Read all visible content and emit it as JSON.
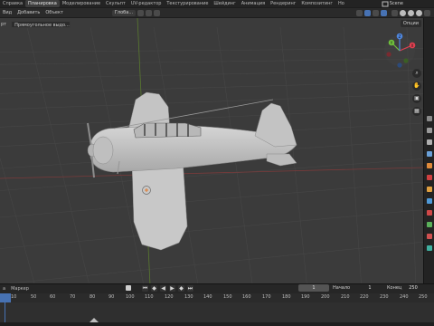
{
  "topbar": {
    "workspaces": [
      "Справка",
      "Планировка",
      "Моделирование",
      "Скульпт",
      "UV-редактор",
      "Текстурирование",
      "Шейдинг",
      "Анимация",
      "Рендеринг",
      "Композитинг",
      "Но"
    ],
    "active_workspace": "Планировка",
    "scene_label": "Scene"
  },
  "viewport_header": {
    "menus": [
      "Вид",
      "Добавить",
      "Объект"
    ],
    "orientation_dropdown": "Глоба...",
    "icons": [
      "view-object-types-icon",
      "gizmo-toggle-icon",
      "overlays-icon",
      "xray-icon",
      "shading-wire-icon",
      "shading-solid-icon",
      "shading-material-icon",
      "shading-rendered-icon"
    ]
  },
  "tool_header": {
    "label": "рт",
    "mode_dropdown": "Прямоугольное выдо...",
    "options_label": "Опции"
  },
  "navigation": {
    "gizmo_axes": [
      "X",
      "Y",
      "Z"
    ],
    "tools": [
      "zoom-icon",
      "pan-icon",
      "camera-icon",
      "ortho-grid-icon"
    ]
  },
  "properties_tabs": [
    {
      "icon": "tool-icon",
      "color": "#8a8a8a"
    },
    {
      "icon": "render-icon",
      "color": "#9a9a9a"
    },
    {
      "icon": "output-icon",
      "color": "#b0b0b0"
    },
    {
      "icon": "view-layer-icon",
      "color": "#6aa0d8"
    },
    {
      "icon": "scene-icon",
      "color": "#e08a3a"
    },
    {
      "icon": "world-icon",
      "color": "#d04040"
    },
    {
      "icon": "object-icon",
      "color": "#e0a040"
    },
    {
      "icon": "modifier-icon",
      "color": "#4f9ad8"
    },
    {
      "icon": "particles-icon",
      "color": "#d04848"
    },
    {
      "icon": "physics-icon",
      "color": "#5ab05a"
    },
    {
      "icon": "constraints-icon",
      "color": "#d05050"
    },
    {
      "icon": "data-icon",
      "color": "#40b0a0"
    }
  ],
  "timeline": {
    "menus": [
      "а",
      "Маркер"
    ],
    "current_frame": "1",
    "start_label": "Начало",
    "start_value": "1",
    "end_label": "Конец",
    "end_value": "250",
    "ruler_ticks": [
      "10",
      "50",
      "60",
      "70",
      "80",
      "90",
      "100",
      "110",
      "120",
      "130",
      "140",
      "150",
      "160",
      "170",
      "180",
      "190",
      "200",
      "210",
      "220",
      "230",
      "240",
      "250"
    ]
  },
  "colors": {
    "accent": "#4772b3",
    "axis_x": "#e04050",
    "axis_y": "#6fbf3c",
    "axis_z": "#4f86dd",
    "model": "#c8c8c8"
  }
}
